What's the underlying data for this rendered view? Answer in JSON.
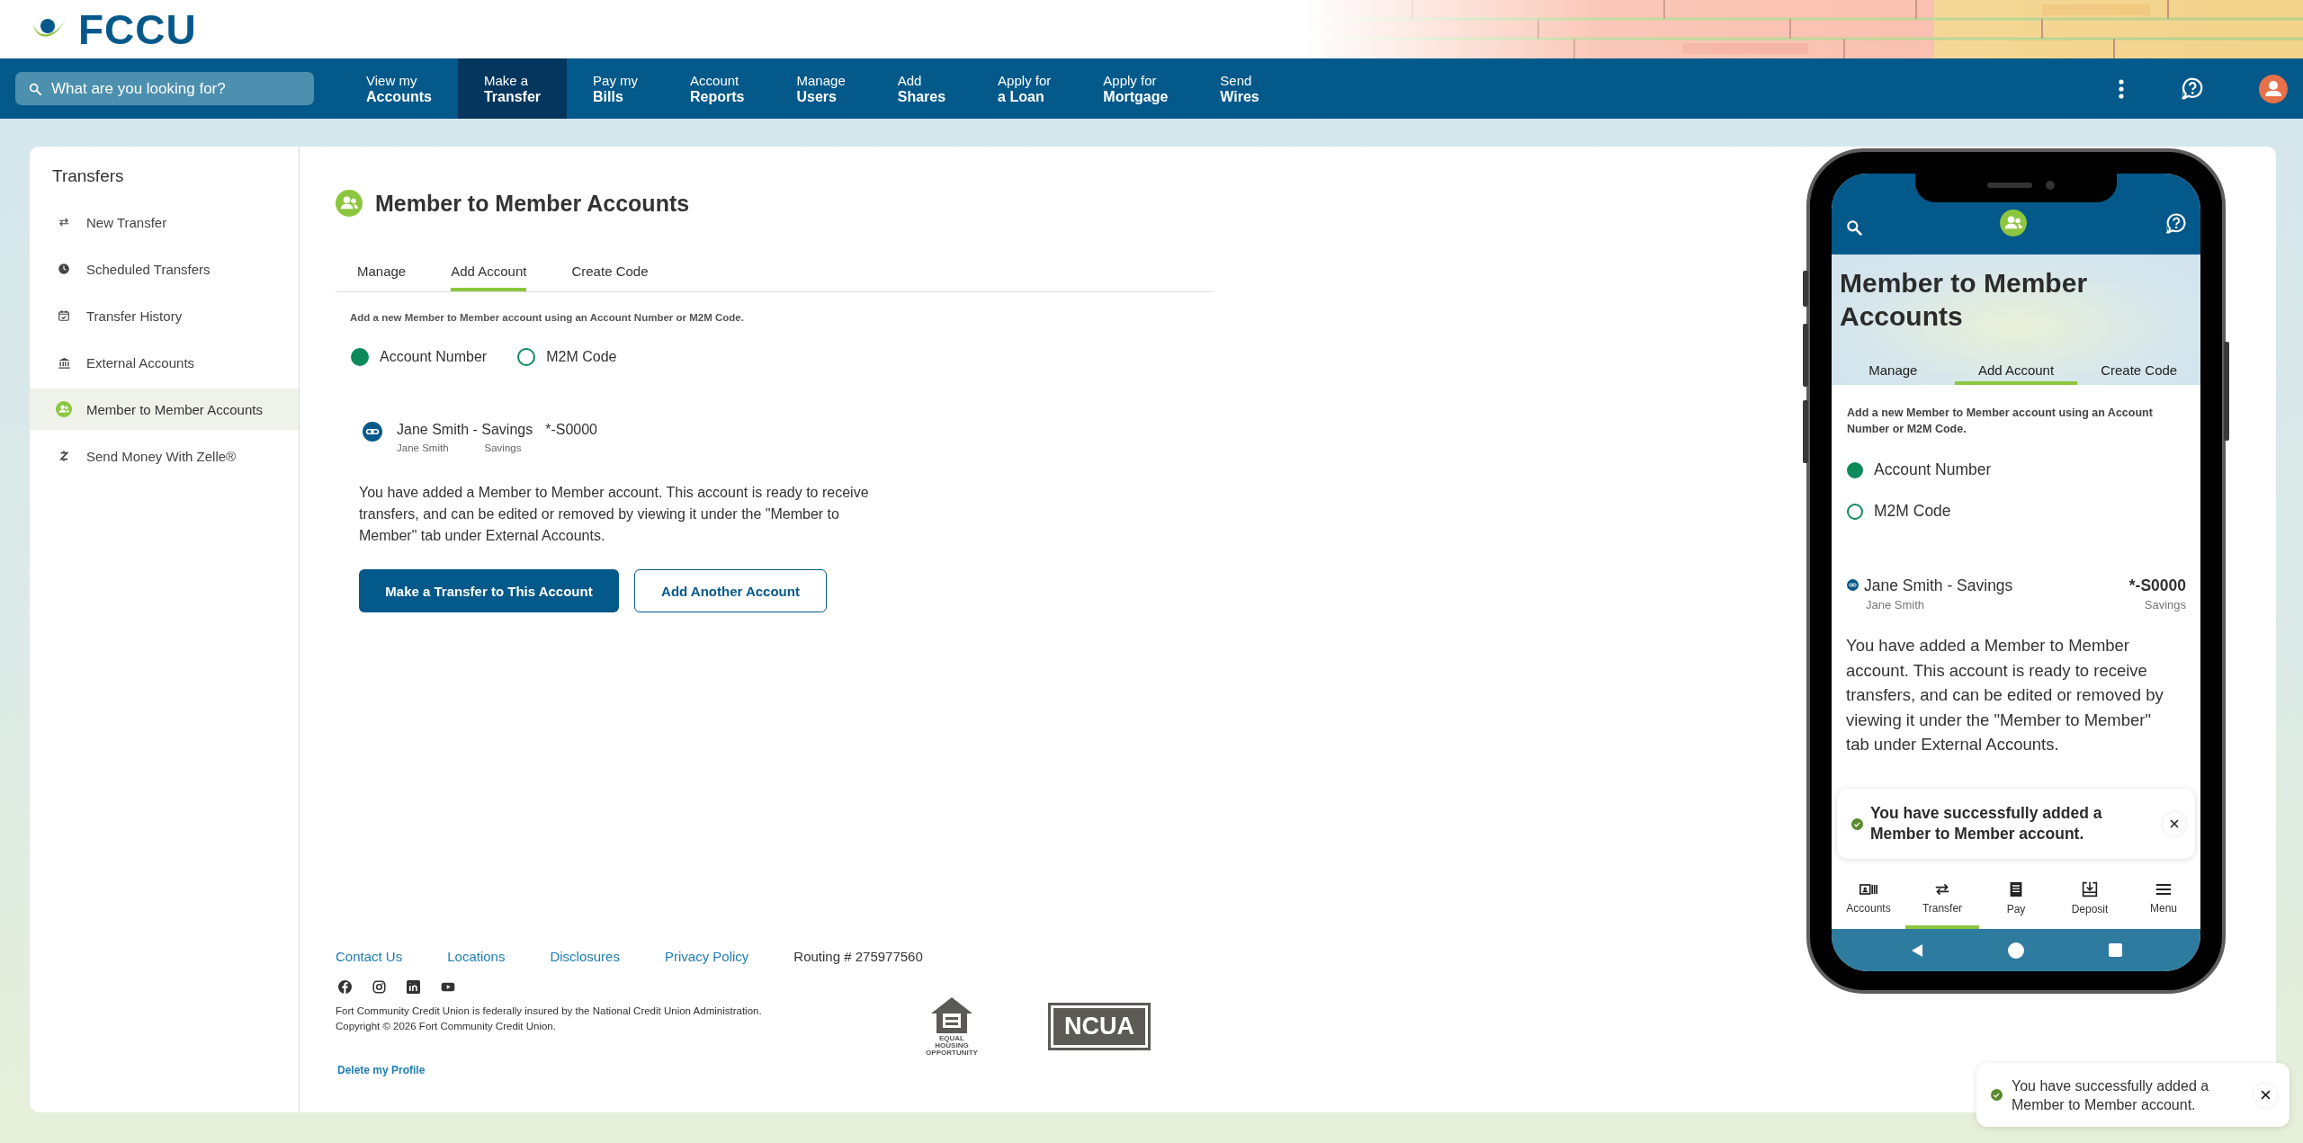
{
  "header": {
    "logo": "FCCU"
  },
  "nav": {
    "search": {
      "placeholder": "What are you looking for?"
    },
    "items": [
      {
        "line1": "View my",
        "line2": "Accounts",
        "selected": false
      },
      {
        "line1": "Make a",
        "line2": "Transfer",
        "selected": true
      },
      {
        "line1": "Pay my",
        "line2": "Bills",
        "selected": false
      },
      {
        "line1": "Account",
        "line2": "Reports",
        "selected": false
      },
      {
        "line1": "Manage",
        "line2": "Users",
        "selected": false
      },
      {
        "line1": "Add",
        "line2": "Shares",
        "selected": false
      },
      {
        "line1": "Apply for",
        "line2": "a Loan",
        "selected": false
      },
      {
        "line1": "Apply for",
        "line2": "Mortgage",
        "selected": false
      },
      {
        "line1": "Send",
        "line2": "Wires",
        "selected": false
      }
    ]
  },
  "sidebar": {
    "title": "Transfers",
    "items": [
      {
        "label": "New Transfer",
        "selected": false
      },
      {
        "label": "Scheduled Transfers",
        "selected": false
      },
      {
        "label": "Transfer History",
        "selected": false
      },
      {
        "label": "External Accounts",
        "selected": false
      },
      {
        "label": "Member to Member Accounts",
        "selected": true
      },
      {
        "label": "Send Money With Zelle®",
        "selected": false
      }
    ]
  },
  "page": {
    "title": "Member to Member Accounts",
    "tabs": [
      {
        "label": "Manage",
        "selected": false
      },
      {
        "label": "Add Account",
        "selected": true
      },
      {
        "label": "Create Code",
        "selected": false
      }
    ],
    "instructions": "Add a new Member to Member account using an Account Number or M2M Code.",
    "radios": [
      {
        "label": "Account Number",
        "selected": true
      },
      {
        "label": "M2M Code",
        "selected": false
      }
    ],
    "account": {
      "name": "Jane Smith - Savings",
      "number": "*-S0000",
      "owner": "Jane Smith",
      "type": "Savings"
    },
    "message": "You have added a Member to Member account. This account is ready to receive transfers, and can be edited or removed by viewing it under the \"Member to Member\" tab under External Accounts.",
    "buttons": [
      {
        "label": "Make a Transfer to This Account",
        "kind": "primary"
      },
      {
        "label": "Add Another Account",
        "kind": "secondary"
      }
    ]
  },
  "footer": {
    "links": [
      "Contact Us",
      "Locations",
      "Disclosures",
      "Privacy Policy"
    ],
    "routing": "Routing # 275977560",
    "insurance": "Fort Community Credit Union is federally insured by the National Credit Union Administration.",
    "copyright": "Copyright © 2026 Fort Community Credit Union.",
    "delete_link": "Delete my Profile",
    "equal_housing": "EQUAL HOUSING OPPORTUNITY",
    "ncua": "NCUA"
  },
  "phone": {
    "title": "Member to Member Accounts",
    "tabs": [
      {
        "label": "Manage",
        "selected": false
      },
      {
        "label": "Add Account",
        "selected": true
      },
      {
        "label": "Create Code",
        "selected": false
      }
    ],
    "instructions": "Add a new Member to Member account using an Account Number or M2M Code.",
    "radios": [
      {
        "label": "Account Number",
        "selected": true
      },
      {
        "label": "M2M Code",
        "selected": false
      }
    ],
    "account": {
      "name": "Jane Smith - Savings",
      "number": "*-S0000",
      "owner": "Jane Smith",
      "type": "Savings"
    },
    "message": "You have added a Member to Member account. This account is ready to receive transfers, and can be edited or removed by viewing it under the \"Member to Member\" tab under External Accounts.",
    "toast": {
      "message": "You have successfully added a Member to Member account."
    },
    "bottom_nav": [
      {
        "label": "Accounts",
        "selected": false
      },
      {
        "label": "Transfer",
        "selected": true
      },
      {
        "label": "Pay",
        "selected": false
      },
      {
        "label": "Deposit",
        "selected": false
      },
      {
        "label": "Menu",
        "selected": false
      }
    ]
  },
  "toast": {
    "message": "You have successfully added a Member to Member account."
  }
}
